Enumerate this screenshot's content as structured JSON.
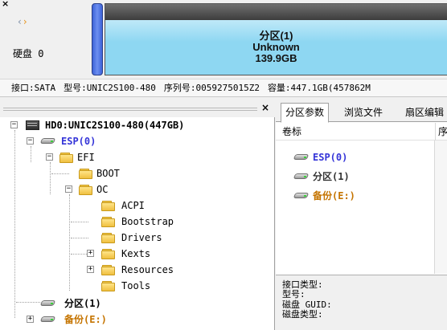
{
  "top": {
    "close_glyph": "×",
    "nav_back": "‹",
    "nav_forward": "›",
    "disk_label": "硬盘 0",
    "partition": {
      "name": "分区(1)",
      "fs": "Unknown",
      "size": "139.9GB"
    }
  },
  "info_line": {
    "interface": "接口:SATA",
    "model": "型号:UNIC2S100-480",
    "serial": "序列号:0059275015Z2",
    "capacity": "容量:447.1GB(457862M"
  },
  "left_pane": {
    "close_glyph": "×",
    "tree": [
      {
        "label": "HD0:UNIC2S100-480(447GB)",
        "style": "bold",
        "icon": "hdd-icon",
        "expander": "−"
      },
      {
        "label": "ESP(0)",
        "style": "blue",
        "icon": "drive-icon",
        "expander": "−"
      },
      {
        "label": "EFI",
        "icon": "folder-icon",
        "expander": "−"
      },
      {
        "label": "BOOT",
        "icon": "folder-icon"
      },
      {
        "label": "OC",
        "icon": "folder-icon",
        "expander": "−"
      },
      {
        "label": "ACPI",
        "icon": "folder-icon"
      },
      {
        "label": "Bootstrap",
        "icon": "folder-icon"
      },
      {
        "label": "Drivers",
        "icon": "folder-icon"
      },
      {
        "label": "Kexts",
        "icon": "folder-icon",
        "expander": "+"
      },
      {
        "label": "Resources",
        "icon": "folder-icon",
        "expander": "+"
      },
      {
        "label": "Tools",
        "icon": "folder-icon"
      },
      {
        "label": "分区(1)",
        "style": "bold",
        "icon": "drive-icon"
      },
      {
        "label": "备份(E:)",
        "style": "orange",
        "icon": "drive-icon",
        "expander": "+"
      }
    ]
  },
  "right_pane": {
    "tabs": [
      "分区参数",
      "浏览文件",
      "扇区编辑"
    ],
    "active_tab": "分区参数",
    "columns": [
      "卷标",
      "序"
    ],
    "partitions": [
      {
        "label": "ESP(0)",
        "color": "#3434d8"
      },
      {
        "label": "分区(1)",
        "color": "#333333"
      },
      {
        "label": "备份(E:)",
        "color": "#c57400"
      }
    ],
    "properties": [
      "接口类型:",
      "型号:",
      "磁盘 GUID:",
      "磁盘类型:"
    ]
  },
  "colors": {
    "partition_fill": "#8ed7f2",
    "esp_blue": "#3434d8",
    "backup_orange": "#c57400"
  }
}
